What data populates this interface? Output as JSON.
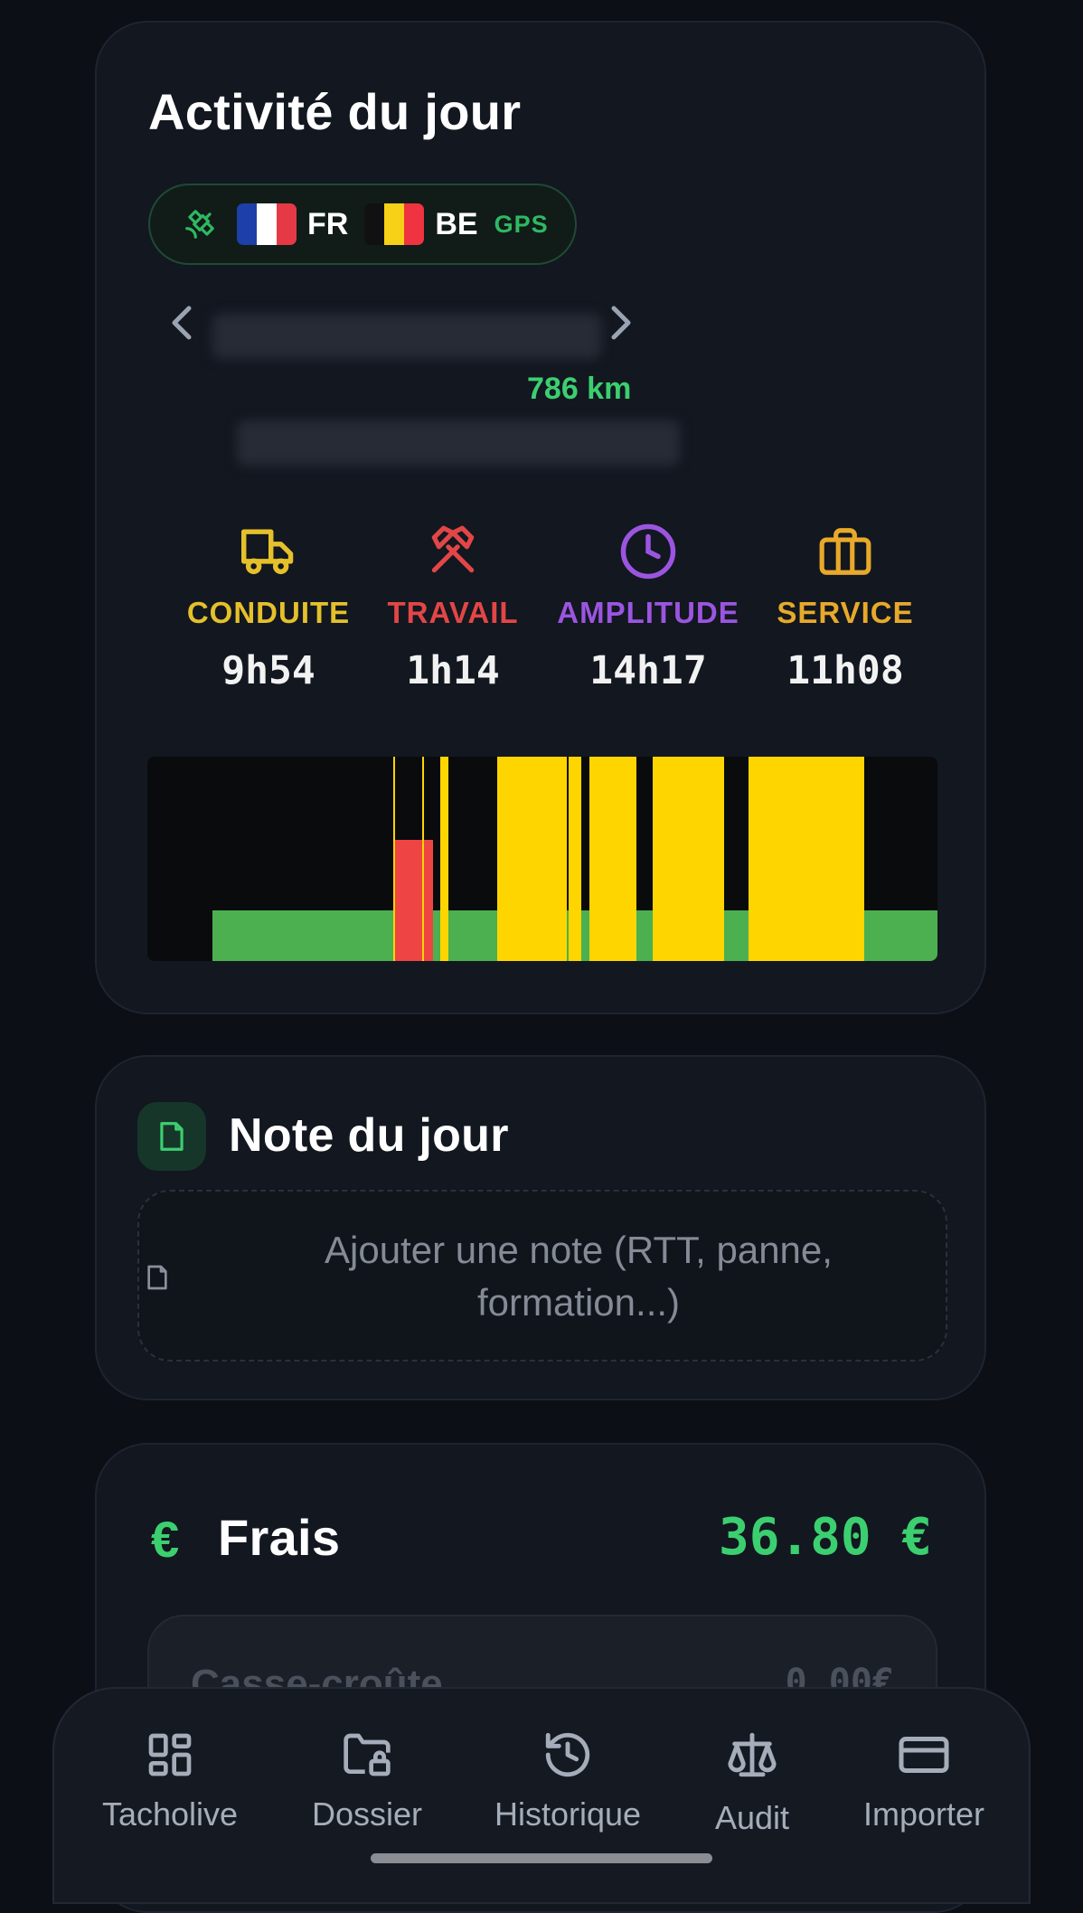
{
  "activity": {
    "title": "Activité du jour",
    "countries": [
      {
        "code": "FR",
        "colors": [
          "#1d3fa8",
          "#ffffff",
          "#e63946"
        ]
      },
      {
        "code": "BE",
        "colors": [
          "#111111",
          "#f7d117",
          "#ef3340"
        ]
      }
    ],
    "gps_label": "GPS",
    "distance": "786 km",
    "stats": [
      {
        "icon": "truck-icon",
        "label": "CONDUITE",
        "value": "9h54",
        "color": "#e5c02a"
      },
      {
        "icon": "hammers-icon",
        "label": "TRAVAIL",
        "value": "1h14",
        "color": "#e24646"
      },
      {
        "icon": "clock-icon",
        "label": "AMPLITUDE",
        "value": "14h17",
        "color": "#9b55e0"
      },
      {
        "icon": "briefcase-icon",
        "label": "SERVICE",
        "value": "11h08",
        "color": "#e8a92a"
      }
    ],
    "timeline_colors": {
      "drive": "#ffd500",
      "work": "#ef4444",
      "rest": "#4caf50",
      "none": "#0a0b0d"
    }
  },
  "note": {
    "title": "Note du jour",
    "placeholder": "Ajouter une note (RTT, panne, formation...)"
  },
  "frais": {
    "icon": "euro-icon",
    "title": "Frais",
    "total": "36.80 €",
    "first_row_label": "Casse-croûte",
    "first_row_value": "0.00€"
  },
  "bottom_nav": [
    {
      "icon": "dashboard-icon",
      "label": "Tacholive"
    },
    {
      "icon": "folder-lock-icon",
      "label": "Dossier"
    },
    {
      "icon": "history-icon",
      "label": "Historique"
    },
    {
      "icon": "scales-icon",
      "label": "Audit"
    },
    {
      "icon": "card-icon",
      "label": "Importer"
    }
  ]
}
